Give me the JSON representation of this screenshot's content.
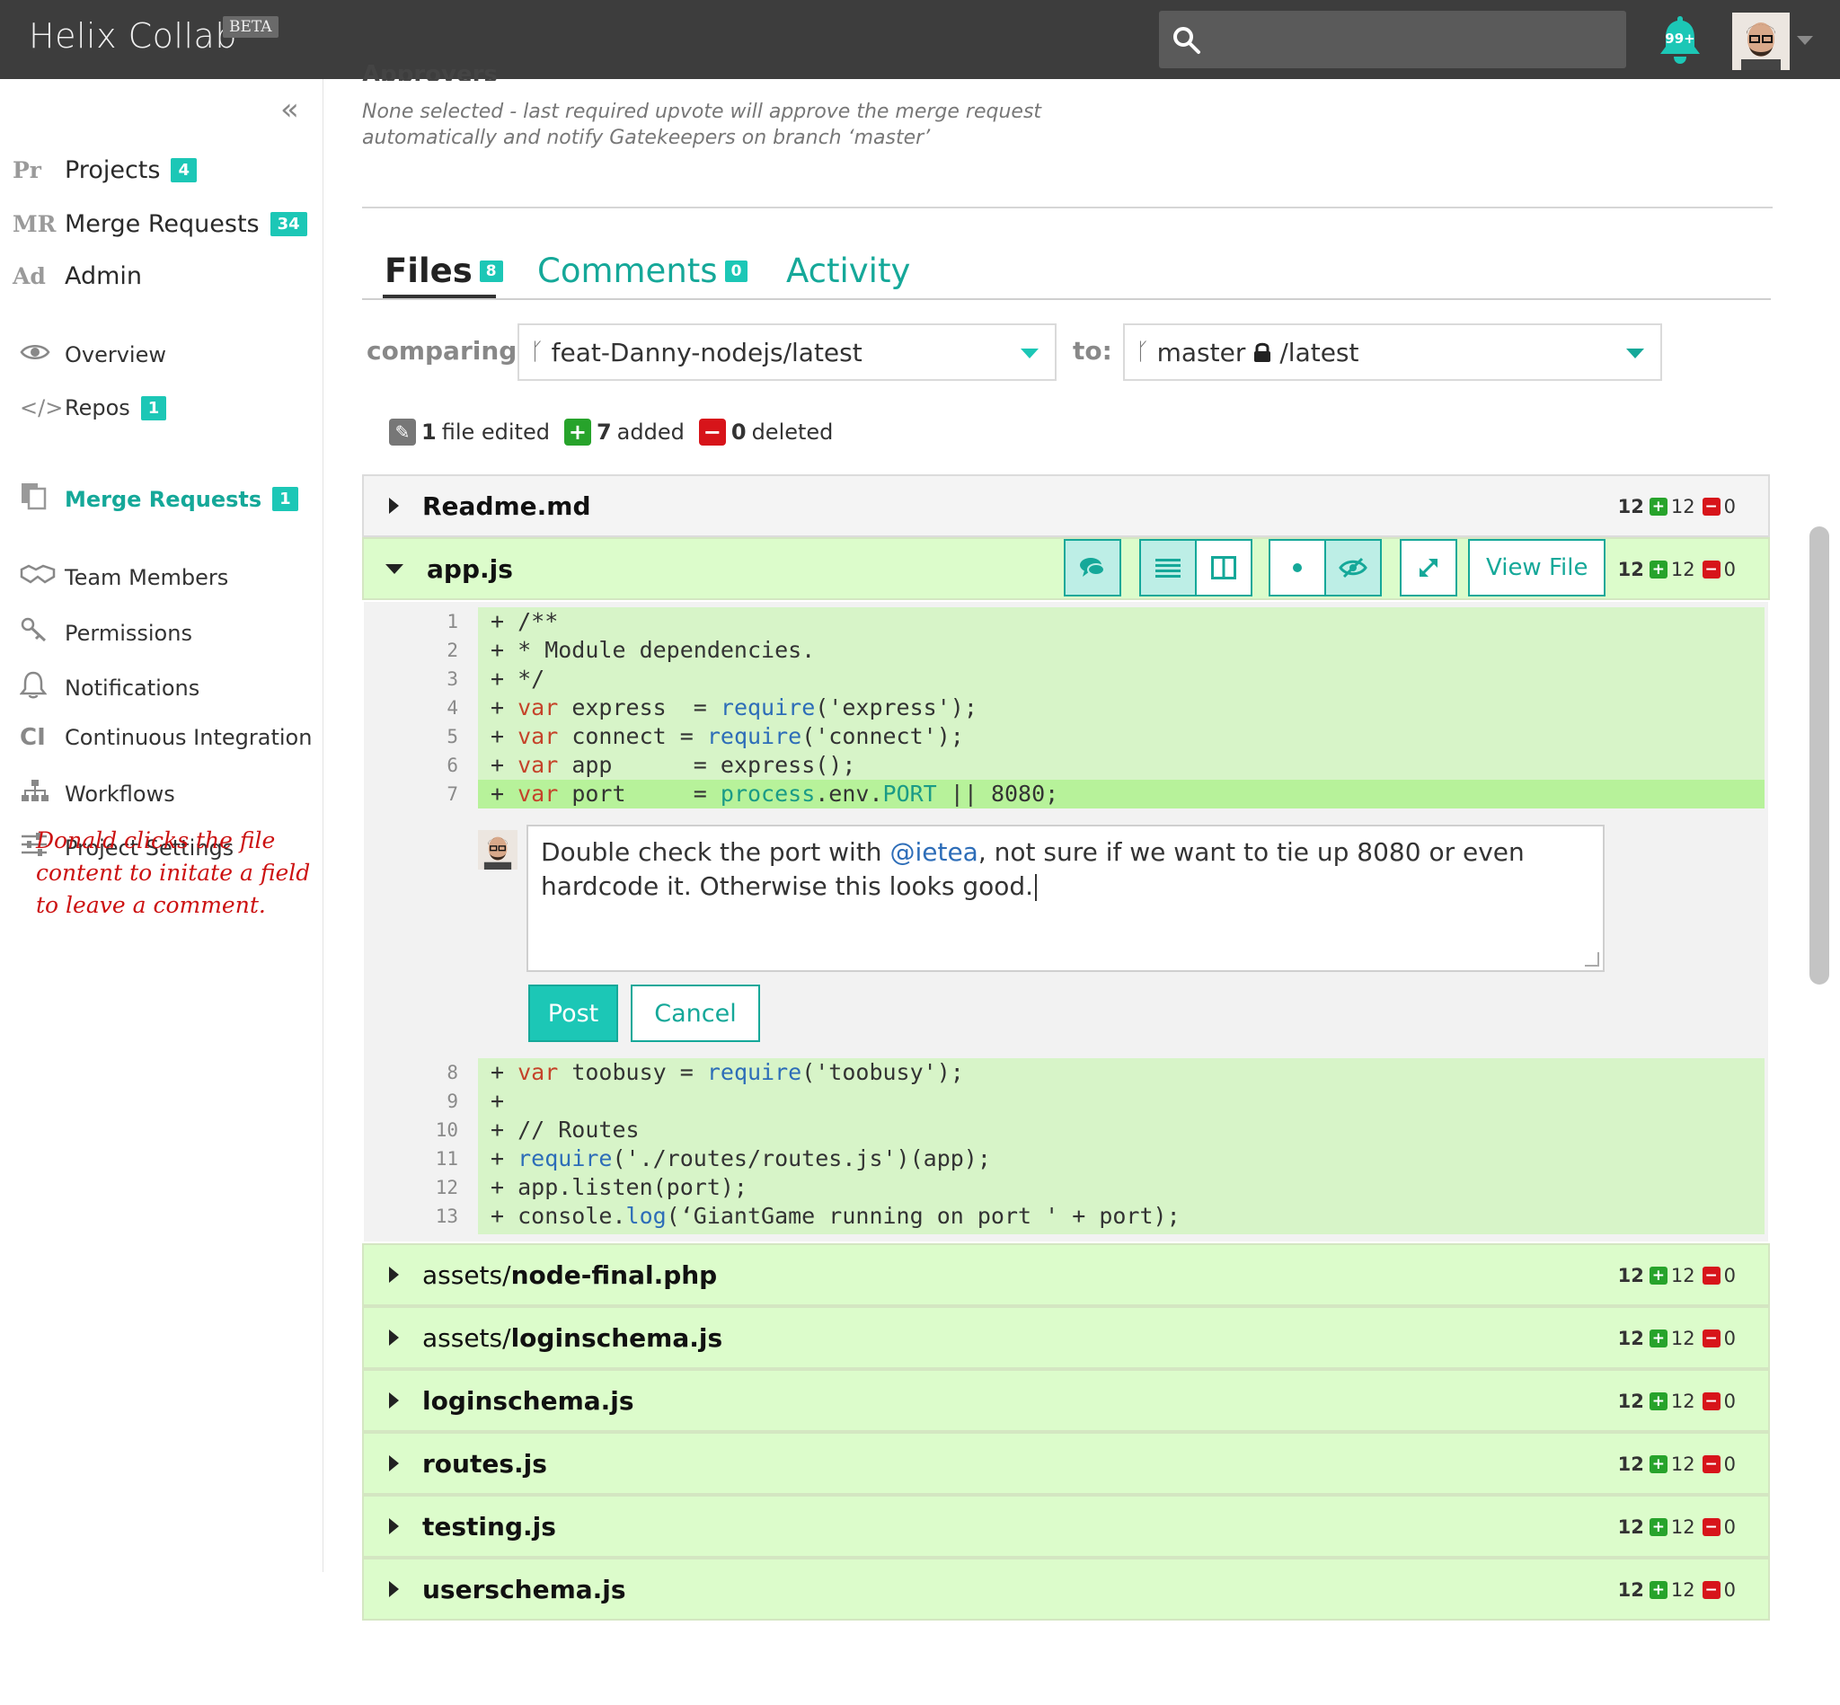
{
  "app": {
    "name": "Helix Collab",
    "badge": "BETA"
  },
  "header": {
    "notifications": "99+"
  },
  "sidebar": {
    "top": [
      {
        "abbr": "Pr",
        "label": "Projects",
        "count": "4"
      },
      {
        "abbr": "MR",
        "label": "Merge Requests",
        "count": "34"
      },
      {
        "abbr": "Ad",
        "label": "Admin"
      }
    ],
    "items": [
      {
        "label": "Overview",
        "icon": "eye-icon"
      },
      {
        "label": "Repos",
        "icon": "code-icon",
        "count": "1"
      },
      {
        "label": "Merge Requests",
        "icon": "merge-request-icon",
        "count": "1",
        "active": true
      },
      {
        "label": "Team Members",
        "icon": "handshake-icon"
      },
      {
        "label": "Permissions",
        "icon": "key-icon"
      },
      {
        "label": "Notifications",
        "icon": "bell-icon"
      },
      {
        "label": "Continuous Integration",
        "icon": "ci-icon",
        "glyph": "CI"
      },
      {
        "label": "Workflows",
        "icon": "workflow-icon"
      },
      {
        "label": "Project Settings",
        "icon": "sliders-icon"
      }
    ],
    "note": "Donald clicks the file content to initate a field to leave a comment."
  },
  "approvers": {
    "title": "Approvers",
    "desc_line1": "None selected - last required upvote will approve the merge request",
    "desc_line2": "automatically and notify Gatekeepers on branch ‘master’"
  },
  "tabs": [
    {
      "label": "Files",
      "count": "8",
      "active": true
    },
    {
      "label": "Comments",
      "count": "0"
    },
    {
      "label": "Activity"
    }
  ],
  "compare": {
    "label": "comparing:",
    "source": "feat-Danny-nodejs/latest",
    "to_label": "to:",
    "target_branch": "master",
    "target_suffix": "/latest"
  },
  "summary": {
    "edited_count": "1",
    "edited_label": "file edited",
    "added_count": "7",
    "added_label": "added",
    "deleted_count": "0",
    "deleted_label": "deleted"
  },
  "toolbar": {
    "view_file": "View File"
  },
  "files": [
    {
      "dir": "",
      "name": "Readme.md",
      "total": "12",
      "added": "12",
      "deleted": "0"
    },
    {
      "dir": "",
      "name": "app.js",
      "total": "12",
      "added": "12",
      "deleted": "0"
    },
    {
      "dir": "assets/",
      "name": "node-final.php",
      "total": "12",
      "added": "12",
      "deleted": "0"
    },
    {
      "dir": "assets/",
      "name": "loginschema.js",
      "total": "12",
      "added": "12",
      "deleted": "0"
    },
    {
      "dir": "",
      "name": "loginschema.js",
      "total": "12",
      "added": "12",
      "deleted": "0"
    },
    {
      "dir": "",
      "name": "routes.js",
      "total": "12",
      "added": "12",
      "deleted": "0"
    },
    {
      "dir": "",
      "name": "testing.js",
      "total": "12",
      "added": "12",
      "deleted": "0"
    },
    {
      "dir": "",
      "name": "userschema.js",
      "total": "12",
      "added": "12",
      "deleted": "0"
    }
  ],
  "code_top": [
    {
      "n": "1",
      "text": "+ /**"
    },
    {
      "n": "2",
      "text": "+ * Module dependencies."
    },
    {
      "n": "3",
      "text": "+ */"
    },
    {
      "n": "4",
      "text": "+ var express  = require('express');"
    },
    {
      "n": "5",
      "text": "+ var connect = require('connect');"
    },
    {
      "n": "6",
      "text": "+ var app      = express();"
    },
    {
      "n": "7",
      "text": "+ var port     = process.env.PORT || 8080;"
    }
  ],
  "code_bottom": [
    {
      "n": "8",
      "text": "+ var toobusy = require('toobusy');"
    },
    {
      "n": "9",
      "text": "+"
    },
    {
      "n": "10",
      "text": "+ // Routes"
    },
    {
      "n": "11",
      "text": "+ require('./routes/routes.js')(app);"
    },
    {
      "n": "12",
      "text": "+ app.listen(port);"
    },
    {
      "n": "13",
      "text": "+ console.log(‘GiantGame running on port ' + port);"
    }
  ],
  "comment": {
    "before": "Double check the port with ",
    "mention": "@ietea",
    "after_line1": ", not sure if we want to tie up 8080 or even",
    "line2": "hardcode it. Otherwise this looks good.",
    "post": "Post",
    "cancel": "Cancel"
  }
}
